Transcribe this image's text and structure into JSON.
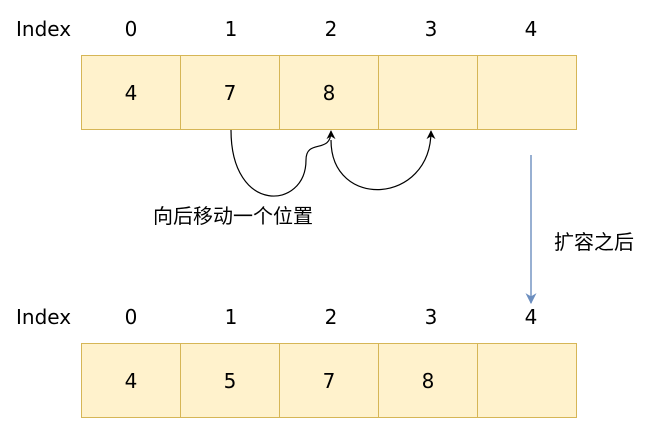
{
  "top": {
    "index_label": "Index",
    "indices": [
      "0",
      "1",
      "2",
      "3",
      "4"
    ],
    "cells": [
      "4",
      "7",
      "8",
      "",
      ""
    ]
  },
  "bottom": {
    "index_label": "Index",
    "indices": [
      "0",
      "1",
      "2",
      "3",
      "4"
    ],
    "cells": [
      "4",
      "5",
      "7",
      "8",
      ""
    ]
  },
  "annotations": {
    "shift": "向后移动一个位置",
    "expand": "扩容之后"
  },
  "colors": {
    "cell_fill": "#fff2cc",
    "cell_border": "#d6b656",
    "expand_arrow": "#6c8ebf"
  }
}
